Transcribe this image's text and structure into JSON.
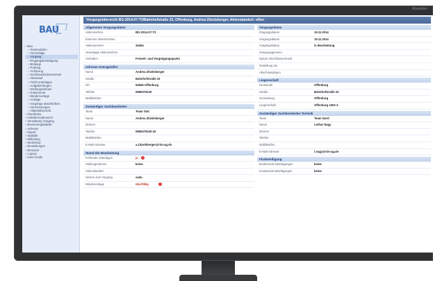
{
  "window": {
    "corner_label": "Abmelden"
  },
  "logo": {
    "text": "BAU",
    "sub": "plus"
  },
  "sidebar": {
    "items": [
      {
        "label": "Bau",
        "level": 1
      },
      {
        "label": "Stammdaten",
        "level": 2
      },
      {
        "label": "Vorschläge",
        "level": 2
      },
      {
        "label": "Vorgang",
        "level": 2,
        "active": true
      },
      {
        "label": "Eingangsbestätigung",
        "level": 2
      },
      {
        "label": "Belange",
        "level": 2
      },
      {
        "label": "Prüfung",
        "level": 2
      },
      {
        "label": "Anhörung",
        "level": 2
      },
      {
        "label": "Sachbearbeiterwechsel",
        "level": 2
      },
      {
        "label": "Aktenlauf",
        "level": 2
      },
      {
        "label": "Fehlt Unterlagen",
        "level": 2
      },
      {
        "label": "Aufgabenbogen",
        "level": 2
      },
      {
        "label": "Stellungnahmen",
        "level": 2
      },
      {
        "label": "Dokumente",
        "level": 2
      },
      {
        "label": "Wiedervorlage",
        "level": 2
      },
      {
        "label": "Anträge",
        "level": 2
      },
      {
        "label": "Vorgänge abschließen",
        "level": 2
      },
      {
        "label": "Vermessungen",
        "level": 2
      },
      {
        "label": "Objektübersicht",
        "level": 2
      },
      {
        "label": "Flurstücke",
        "level": 1
      },
      {
        "label": "Gebührenübersicht",
        "level": 1
      },
      {
        "label": "Verwaltung Vorgang",
        "level": 1
      },
      {
        "label": "Bewertungstabelle",
        "level": 1
      },
      {
        "label": "Adresse",
        "level": 1
      },
      {
        "label": "Import",
        "level": 1
      },
      {
        "label": "Statistik",
        "level": 1
      },
      {
        "label": "Mitteilung",
        "level": 1
      },
      {
        "label": "Workshop",
        "level": 1
      },
      {
        "label": "Einstellungen",
        "level": 1
      },
      {
        "label": "Benutzer",
        "level": 1
      },
      {
        "label": "Logout",
        "level": 1
      },
      {
        "label": "User-Guide",
        "level": 1
      }
    ]
  },
  "header": {
    "title": "Vorgangsübersicht BG-2014-07-T3/Bahnhofstraße 23, Offenburg, Andrea Zitzelsberger, Aktenstandort: offen"
  },
  "left": {
    "sections": [
      {
        "title": "Allgemeine Vorgangsdaten",
        "rows": [
          {
            "label": "Aktenzeichen",
            "value": "BG-2014-07-T3"
          },
          {
            "label": "Externes Aktenzeichen",
            "value": ""
          },
          {
            "label": "Aktennummer",
            "value": "34454"
          },
          {
            "label": "Veranlagte Aktenzeichen",
            "value": ""
          },
          {
            "label": "Vorhaben",
            "value": "Freizeit- und Vergnügungsparks"
          }
        ]
      },
      {
        "title": "Adresse Antragsteller",
        "rows": [
          {
            "label": "Name",
            "value": "Andrea Zitzelsberger"
          },
          {
            "label": "Straße",
            "value": "Bahnhofstraße 23"
          },
          {
            "label": "Ort",
            "value": "54566 Offenburg"
          },
          {
            "label": "Telefon",
            "value": "0895376100"
          },
          {
            "label": "Mobiltelefon",
            "value": ""
          }
        ]
      },
      {
        "title": "Zuständiger Sachbearbeiter",
        "rows": [
          {
            "label": "Team",
            "value": "Team Süd"
          },
          {
            "label": "Name",
            "value": "Andrea Zitzelsberger"
          },
          {
            "label": "Zimmer",
            "value": ""
          },
          {
            "label": "Telefon",
            "value": "0895376100-20"
          },
          {
            "label": "Mobiltelefon",
            "value": ""
          },
          {
            "label": "E-Mail-Adresse",
            "value": "a.zitzelsberger@rim-ag.de"
          }
        ]
      },
      {
        "title": "Stand der Bearbeitung",
        "rows": [
          {
            "label": "Fehlende Unterlagen",
            "value": "ja",
            "red": true,
            "badge": "!"
          },
          {
            "label": "Stellungnahmen",
            "value": "keine"
          },
          {
            "label": "Aktenstandort",
            "value": ""
          },
          {
            "label": "Heizen zum Vorgang",
            "value": "sada"
          },
          {
            "label": "Wiedervorlage",
            "value": "überfällig",
            "red": true,
            "badge": "!"
          }
        ]
      }
    ]
  },
  "right": {
    "sections": [
      {
        "title": "Vorgangsdaten",
        "rows": [
          {
            "label": "Eingangsdatum",
            "value": "19.11.2014"
          },
          {
            "label": "Vorgangsdatum",
            "value": "19.11.2014"
          },
          {
            "label": "Vorgangsstatus",
            "value": "in Bearbeitung"
          },
          {
            "label": "Vorgangsgrenzen",
            "value": ""
          },
          {
            "label": "Datum Abschlussvermerk",
            "value": ""
          },
          {
            "label": "Zustellung am",
            "value": ""
          },
          {
            "label": "Abschlussdatum",
            "value": ""
          }
        ]
      },
      {
        "title": "Liegenschaft",
        "rows": [
          {
            "label": "Gemeinde",
            "value": "Offenburg"
          },
          {
            "label": "Straße",
            "value": "Bahnhofstraße 23"
          },
          {
            "label": "Gemarkung",
            "value": "Offenburg"
          },
          {
            "label": "Liegenschaft",
            "value": "Offenburg 1002-3"
          }
        ]
      },
      {
        "title": "Zuständiger Sachbearbeiter Technik",
        "rows": [
          {
            "label": "Team",
            "value": "Team Nord"
          },
          {
            "label": "Name",
            "value": "Lothar Nagy"
          },
          {
            "label": "Zimmer",
            "value": ""
          },
          {
            "label": "Telefon",
            "value": ""
          },
          {
            "label": "Mobiltelefon",
            "value": ""
          },
          {
            "label": "E-Mail-Adresse",
            "value": "l.nagy@rim-ag.de"
          }
        ]
      },
      {
        "title": "Flurbeteiligung",
        "rows": [
          {
            "label": "bestehende Beteiligungen",
            "value": "keine"
          },
          {
            "label": "erwartende Beteiligungen",
            "value": "keine"
          }
        ]
      }
    ]
  }
}
